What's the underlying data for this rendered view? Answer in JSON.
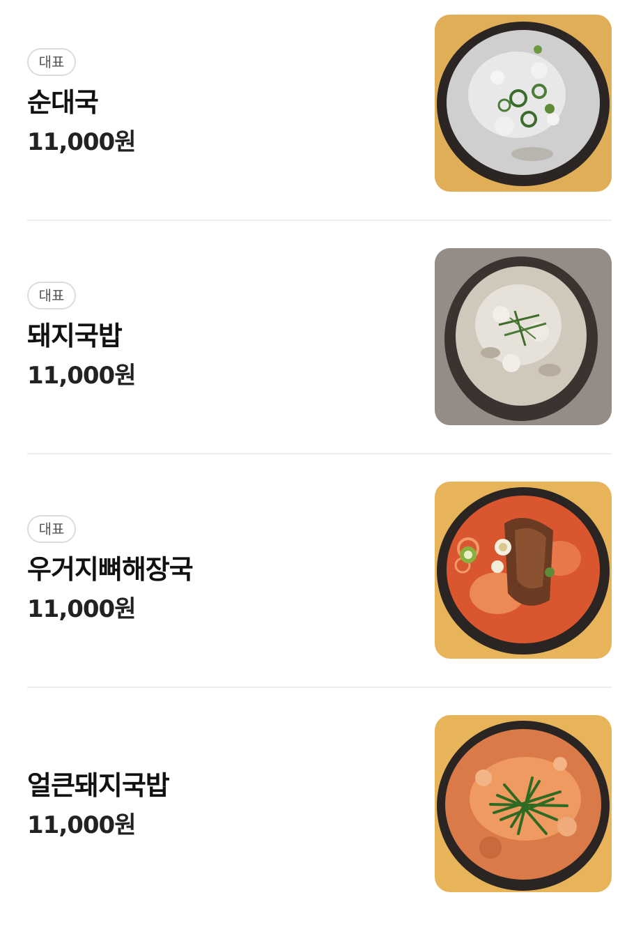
{
  "menu": {
    "items": [
      {
        "badge": "대표",
        "name": "순대국",
        "price": "11,000원",
        "image_icon": "soup-photo-icon",
        "soup_color": "#dadada",
        "table_color": "#e3b25a"
      },
      {
        "badge": "대표",
        "name": "돼지국밥",
        "price": "11,000원",
        "image_icon": "soup-photo-icon",
        "soup_color": "#d8d2c6",
        "table_color": "#8a8480"
      },
      {
        "badge": "대표",
        "name": "우거지뼈해장국",
        "price": "11,000원",
        "image_icon": "soup-photo-icon",
        "soup_color": "#e0633a",
        "table_color": "#e8b45a"
      },
      {
        "name": "얼큰돼지국밥",
        "price": "11,000원",
        "image_icon": "soup-photo-icon",
        "soup_color": "#e9834d",
        "table_color": "#e8b45a"
      }
    ]
  }
}
